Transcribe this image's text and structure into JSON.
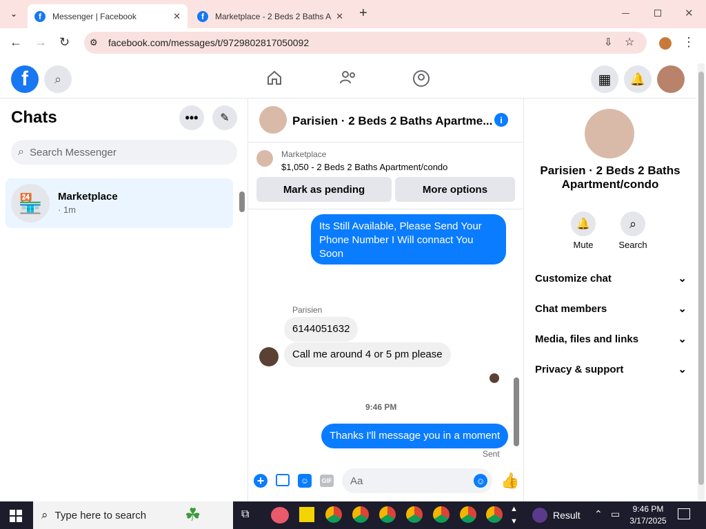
{
  "browser": {
    "tabs": [
      {
        "title": "Messenger | Facebook",
        "active": true
      },
      {
        "title": "Marketplace - 2 Beds 2 Baths Ap",
        "active": false
      }
    ],
    "url": "facebook.com/messages/t/9729802817050092",
    "new_tab": "+",
    "close": "✕"
  },
  "fb": {
    "logo": "f"
  },
  "chats": {
    "title": "Chats",
    "search_placeholder": "Search Messenger",
    "items": [
      {
        "name": "Marketplace",
        "meta": "· 1m"
      }
    ]
  },
  "conversation": {
    "title": "Parisien · 2 Beds 2 Baths Apartme...",
    "listing_source": "Marketplace",
    "listing_info": "$1,050 - 2 Beds 2 Baths Apartment/condo",
    "mark_pending": "Mark as pending",
    "more_options": "More options",
    "messages": [
      {
        "from": "me",
        "text": "Its Still Available, Please Send Your Phone Number I Will connact You Soon"
      },
      {
        "from": "Parisien",
        "text": "6144051632"
      },
      {
        "from": "Parisien",
        "text": "Call me around 4 or 5 pm please"
      },
      {
        "from": "me",
        "text": "Thanks I'll message you in a moment"
      }
    ],
    "sender_name": "Parisien",
    "timestamp": "9:46 PM",
    "status": "Sent",
    "composer_placeholder": "Aa",
    "gif_label": "GIF"
  },
  "details": {
    "name": "Parisien · 2 Beds 2 Baths Apartment/condo",
    "mute_label": "Mute",
    "search_label": "Search",
    "sections": [
      "Customize chat",
      "Chat members",
      "Media, files and links",
      "Privacy & support"
    ]
  },
  "taskbar": {
    "search_placeholder": "Type here to search",
    "result_label": "Result",
    "time": "9:46 PM",
    "date": "3/17/2025"
  },
  "colors": {
    "accent": "#0a7cff",
    "fb_blue": "#1877f2",
    "tab_strip": "#fbe3e1"
  }
}
